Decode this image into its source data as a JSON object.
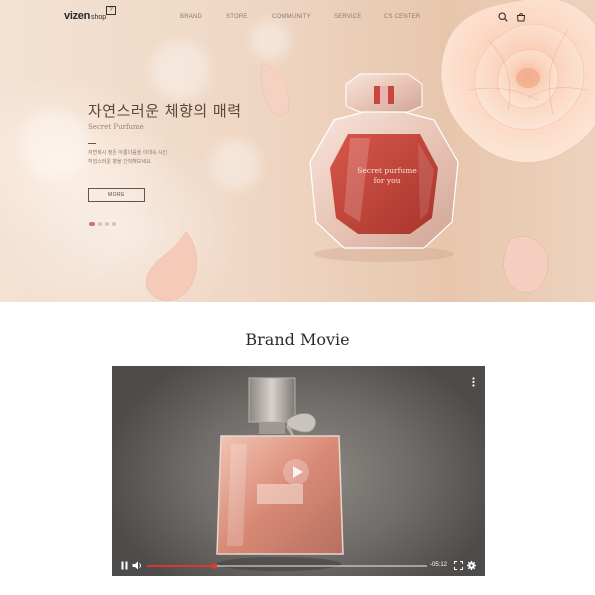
{
  "header": {
    "logo_main": "vizen",
    "logo_sub": "shop",
    "logo_badge": "?",
    "nav": [
      "BRAND",
      "STORE",
      "COMMUNITY",
      "SERVICE",
      "CS CENTER"
    ],
    "icons": [
      "search-icon",
      "cart-icon"
    ]
  },
  "hero": {
    "title": "자연스러운 체향의 매력",
    "subtitle": "Secret Purfume",
    "description_line1": "자연복시 정돈 아롬다음을 이대속 시킨",
    "description_line2": "히엄스러운 향을 간직해보세요.",
    "more_label": "MORE",
    "bottle_label_line1": "Secret purfume",
    "bottle_label_line2": "for you",
    "slide_index": 1,
    "slide_count": 4
  },
  "brand_movie": {
    "title": "Brand Movie",
    "time_display": "-05:12",
    "progress": 0.24,
    "icons": [
      "pause-icon",
      "volume-icon",
      "fullscreen-icon",
      "settings-icon",
      "more-vert-icon",
      "play-icon"
    ]
  },
  "colors": {
    "accent_red": "#d93a2b",
    "hero_text": "#5c463c",
    "hero_accent": "#c07a70"
  }
}
